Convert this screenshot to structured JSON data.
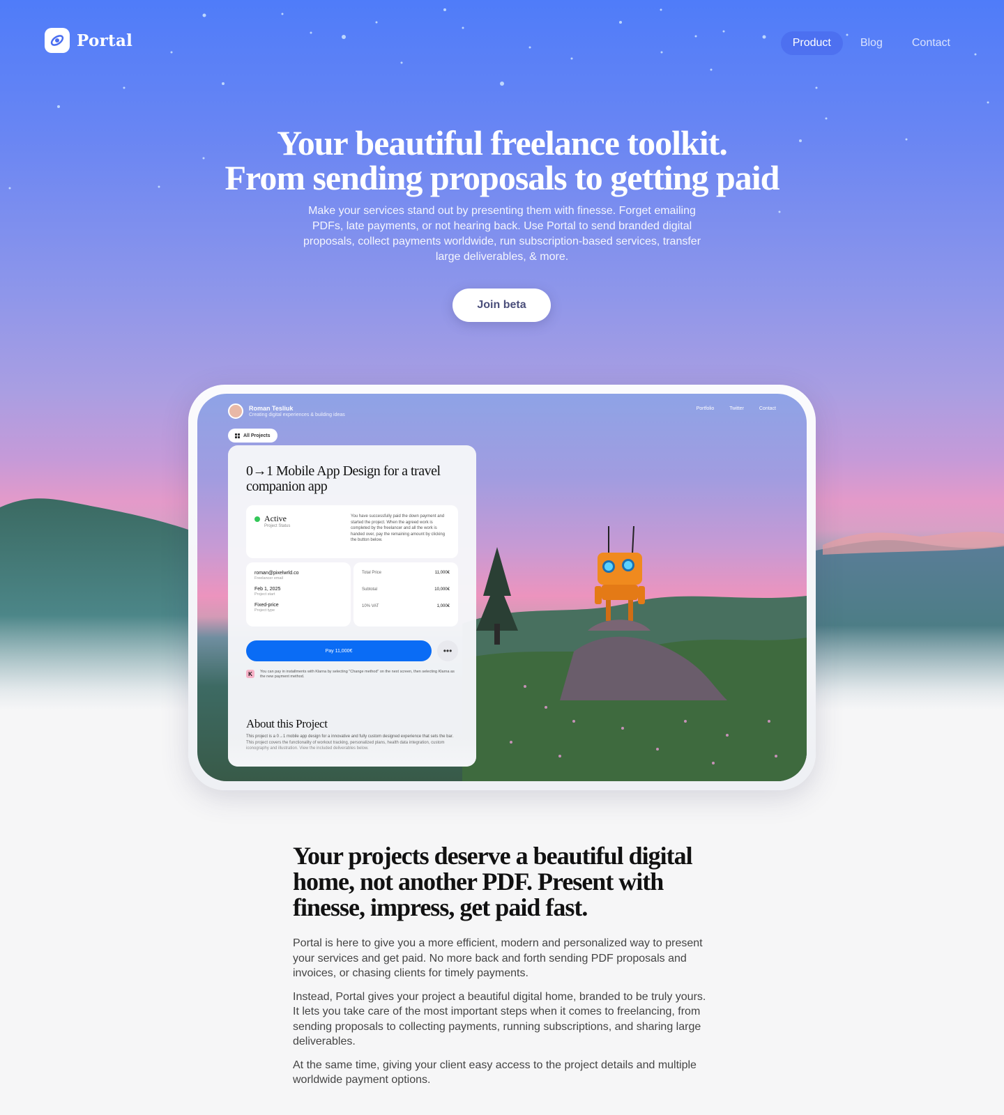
{
  "nav": {
    "logo_text": "Portal",
    "links": [
      "Product",
      "Blog",
      "Contact"
    ],
    "active": "Product"
  },
  "hero": {
    "title_line1": "Your beautiful freelance toolkit.",
    "title_line2": "From sending proposals to getting paid",
    "subtitle": "Make your services stand out by presenting them with finesse. Forget emailing PDFs, late payments, or not hearing back. Use Portal to send branded digital proposals, collect payments worldwide, run subscription-based services, transfer large deliverables, & more.",
    "cta": "Join beta"
  },
  "preview": {
    "user_name": "Roman Tesliuk",
    "user_tagline": "Creating digital experiences & building ideas",
    "nav": [
      "Portfolio",
      "Twitter",
      "Contact"
    ],
    "all_projects": "All Projects",
    "project_title": "0→1 Mobile App Design for a travel companion app",
    "status": "Active",
    "status_label": "Project Status",
    "status_note": "You have successfully paid the down payment and started the project. When the agreed work is completed by the freelancer and all the work is handed over, pay the remaining amount by clicking the button below.",
    "details": [
      {
        "value": "roman@pixelwrld.co",
        "key": "Freelancer email"
      },
      {
        "value": "Feb 1, 2025",
        "key": "Project start"
      },
      {
        "value": "Fixed-price",
        "key": "Project type"
      }
    ],
    "prices": [
      {
        "label": "Total Price",
        "value": "11,000€"
      },
      {
        "label": "Subtotal",
        "value": "10,000€"
      },
      {
        "label": "10% VAT",
        "value": "1,000€"
      }
    ],
    "pay_button": "Pay 11,000€",
    "more_button": "•••",
    "klarna_logo": "K",
    "klarna_note": "You can pay in installments with Klarna by selecting \"Change method\" on the next screen, then selecting Klarna as the new payment method.",
    "about_title": "About this Project",
    "about_text": "This project is a 0→1 mobile app design for a innovative and fully custom designed experience that sets the bar. This project covers the functionality of workout tracking, personalized plans, health data integration, custom iconography and illustration. View the included deliverables below."
  },
  "section": {
    "title": "Your projects deserve a beautiful digital home, not another PDF. Present with finesse, impress, get paid fast.",
    "paragraphs": [
      "Portal is here to give you a more efficient, modern and personalized way to present your services and get paid. No more back and forth sending PDF proposals and invoices, or chasing clients for timely payments.",
      "Instead, Portal gives your project a beautiful digital home, branded to be truly yours. It lets you take care of the most important steps when it comes to freelancing, from sending proposals to collecting payments, running subscriptions, and sharing large deliverables.",
      "At the same time, giving your client easy access to the project details and multiple worldwide payment options."
    ]
  },
  "colors": {
    "sky_top": "#4f7cf9",
    "sunset_pink": "#e49ac9",
    "pay_blue": "#0a6cf5",
    "status_green": "#34c759",
    "robot_orange": "#f08a1e"
  }
}
